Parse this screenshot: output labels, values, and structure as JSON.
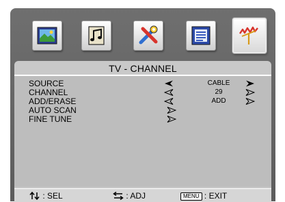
{
  "icon_bar": {
    "icons": [
      {
        "name": "picture-icon",
        "selected": false
      },
      {
        "name": "audio-icon",
        "selected": false
      },
      {
        "name": "setup-tools-icon",
        "selected": false
      },
      {
        "name": "function-menu-icon",
        "selected": false
      },
      {
        "name": "tv-channel-antenna-icon",
        "selected": true
      }
    ]
  },
  "panel": {
    "title": "TV - CHANNEL",
    "rows": [
      {
        "label": "SOURCE",
        "value": "CABLE",
        "left_arrow": "filled",
        "right_arrow": "filled"
      },
      {
        "label": "CHANNEL",
        "value": "29",
        "left_arrow": "outline",
        "right_arrow": "outline"
      },
      {
        "label": "ADD/ERASE",
        "value": "ADD",
        "left_arrow": "outline",
        "right_arrow": "outline"
      },
      {
        "label": "AUTO SCAN",
        "value": "",
        "left_arrow": "none",
        "right_arrow": "outline"
      },
      {
        "label": "FINE TUNE",
        "value": "",
        "left_arrow": "none",
        "right_arrow": "outline"
      }
    ]
  },
  "footer": {
    "sel_label": ": SEL",
    "adj_label": ": ADJ",
    "menu_key": "MENU",
    "exit_label": ": EXIT"
  },
  "colors": {
    "frame": "#666666",
    "panel": "#c9c9c9",
    "content": "#bdbdbd",
    "footer": "#d6d6d6"
  }
}
